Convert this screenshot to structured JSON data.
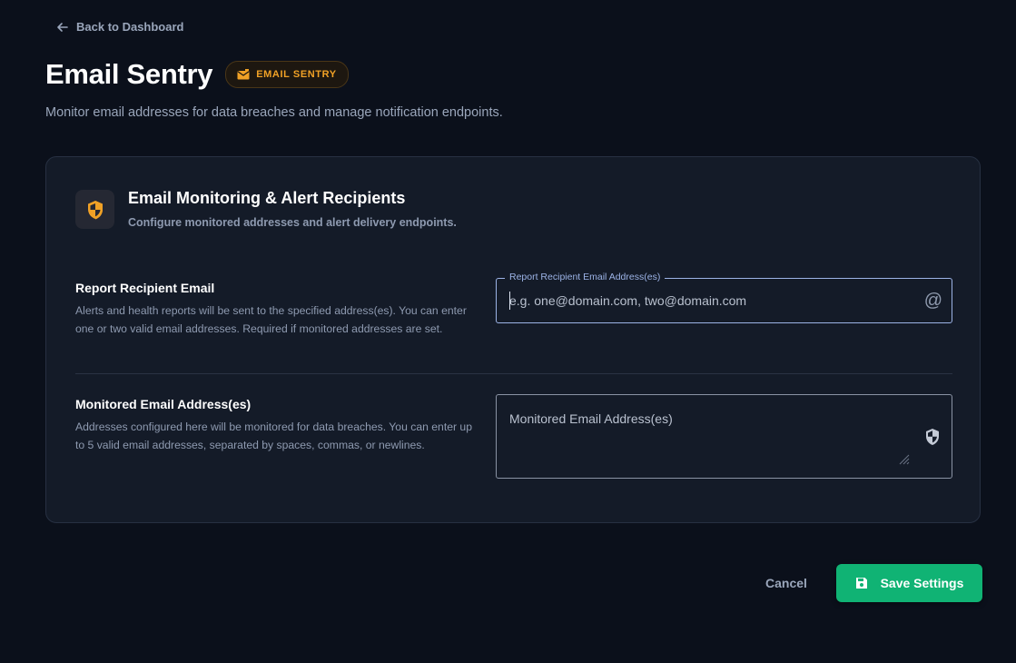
{
  "nav": {
    "back_label": "Back to Dashboard"
  },
  "header": {
    "title": "Email Sentry",
    "badge_label": "EMAIL SENTRY",
    "subtitle": "Monitor email addresses for data breaches and manage notification endpoints."
  },
  "card": {
    "title": "Email Monitoring & Alert Recipients",
    "subtitle": "Configure monitored addresses and alert delivery endpoints.",
    "recipient": {
      "label": "Report Recipient Email",
      "description": "Alerts and health reports will be sent to the specified address(es). You can enter one or two valid email addresses. Required if monitored addresses are set.",
      "field_legend": "Report Recipient Email Address(es)",
      "placeholder": "e.g. one@domain.com, two@domain.com",
      "icon": "at-icon"
    },
    "monitored": {
      "label": "Monitored Email Address(es)",
      "description": "Addresses configured here will be monitored for data breaches. You can enter up to 5 valid email addresses, separated by spaces, commas, or newlines.",
      "placeholder": "Monitored Email Address(es)",
      "icon": "shield-icon"
    }
  },
  "actions": {
    "cancel_label": "Cancel",
    "save_label": "Save Settings"
  },
  "colors": {
    "background": "#0b101b",
    "card": "#141b28",
    "accent_orange": "#f0a126",
    "save_green": "#10b374",
    "field_focus": "#9cb3e6"
  }
}
